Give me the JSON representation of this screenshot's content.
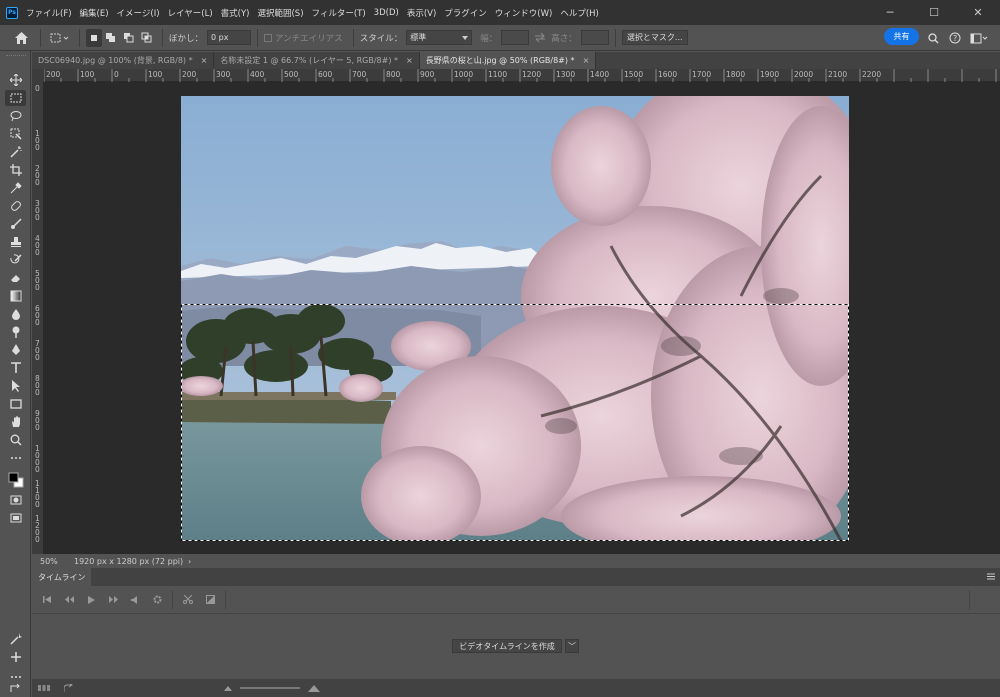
{
  "app": {
    "logo": "Ps"
  },
  "menu": [
    "ファイル(F)",
    "編集(E)",
    "イメージ(I)",
    "レイヤー(L)",
    "書式(Y)",
    "選択範囲(S)",
    "フィルター(T)",
    "3D(D)",
    "表示(V)",
    "プラグイン",
    "ウィンドウ(W)",
    "ヘルプ(H)"
  ],
  "window": {
    "minimize": "─",
    "maximize": "☐",
    "close": "✕"
  },
  "options": {
    "home_icon": "home-icon",
    "feather_label": "ぼかし：",
    "feather_value": "0 px",
    "antialias_label": "アンチエイリアス",
    "style_label": "スタイル：",
    "style_value": "標準",
    "width_label": "幅：",
    "height_label": "高さ：",
    "select_mask": "選択とマスク...",
    "share": "共有"
  },
  "tabs": [
    {
      "label": "DSC06940.jpg @ 100% (背景, RGB/8) *",
      "close": "×"
    },
    {
      "label": "名称未設定 1 @ 66.7% (レイヤー 5, RGB/8#) *",
      "close": "×"
    },
    {
      "label": "長野県の桜と山.jpg @ 50% (RGB/8#) *",
      "close": "×"
    }
  ],
  "ruler_top": [
    "200",
    "100",
    "0",
    "100",
    "200",
    "300",
    "400",
    "500",
    "600",
    "700",
    "800",
    "900",
    "1000",
    "1100",
    "1200",
    "1300",
    "1400",
    "1500",
    "1600",
    "1700",
    "1800",
    "1900",
    "2000",
    "2100",
    "2200"
  ],
  "ruler_left": [
    "0",
    "1\n0\n0",
    "2\n0\n0",
    "3\n0\n0",
    "4\n0\n0",
    "5\n0\n0",
    "6\n0\n0",
    "7\n0\n0",
    "8\n0\n0",
    "9\n0\n0",
    "1\n0\n0\n0",
    "1\n1\n0\n0",
    "1\n2\n0\n0"
  ],
  "status": {
    "zoom": "50%",
    "doc_size": "1920 px x 1280 px (72 ppi)",
    "arrow": "›"
  },
  "timeline": {
    "tab": "タイムライン",
    "create_button": "ビデオタイムラインを作成",
    "dropdown": "﹀",
    "controls": [
      "⏮",
      "◀◀",
      "▶",
      "▶▶",
      "🔊",
      "⚙",
      "✂",
      "◪"
    ]
  },
  "colors": {
    "accent": "#1473e6",
    "sky": "#7fa3c9",
    "water": "#6f8d94",
    "blossom": "#d9b9c4"
  }
}
